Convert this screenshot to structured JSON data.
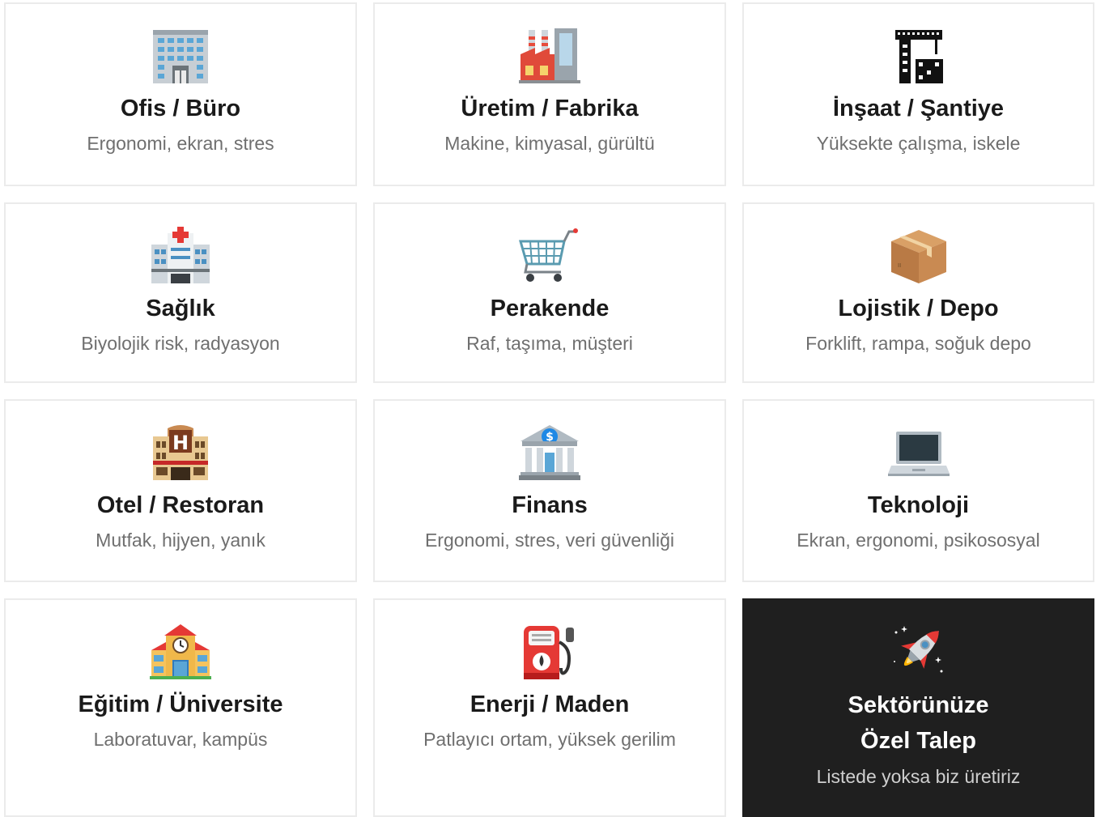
{
  "sectors": [
    {
      "title": "Ofis / Büro",
      "subtitle": "Ergonomi, ekran, stres",
      "icon": "office-building-icon"
    },
    {
      "title": "Üretim / Fabrika",
      "subtitle": "Makine, kimyasal, gürültü",
      "icon": "factory-icon"
    },
    {
      "title": "İnşaat / Şantiye",
      "subtitle": "Yüksekte çalışma, iskele",
      "icon": "construction-crane-icon"
    },
    {
      "title": "Sağlık",
      "subtitle": "Biyolojik risk, radyasyon",
      "icon": "hospital-icon"
    },
    {
      "title": "Perakende",
      "subtitle": "Raf, taşıma, müşteri",
      "icon": "shopping-cart-icon"
    },
    {
      "title": "Lojistik / Depo",
      "subtitle": "Forklift, rampa, soğuk depo",
      "icon": "package-box-icon"
    },
    {
      "title": "Otel / Restoran",
      "subtitle": "Mutfak, hijyen, yanık",
      "icon": "hotel-icon"
    },
    {
      "title": "Finans",
      "subtitle": "Ergonomi, stres, veri güvenliği",
      "icon": "bank-icon"
    },
    {
      "title": "Teknoloji",
      "subtitle": "Ekran, ergonomi, psikososyal",
      "icon": "laptop-icon"
    },
    {
      "title": "Eğitim / Üniversite",
      "subtitle": "Laboratuvar, kampüs",
      "icon": "school-icon"
    },
    {
      "title": "Enerji / Maden",
      "subtitle": "Patlayıcı ortam, yüksek gerilim",
      "icon": "fuel-pump-icon"
    }
  ],
  "special": {
    "title_line1": "Sektörünüze",
    "title_line2": "Özel Talep",
    "subtitle": "Listede yoksa biz üretiriz",
    "icon": "rocket-icon"
  },
  "colors": {
    "card_border": "#ebebeb",
    "title": "#1a1a1a",
    "subtitle": "#6f6f6f",
    "special_bg": "#1f1f1f"
  }
}
